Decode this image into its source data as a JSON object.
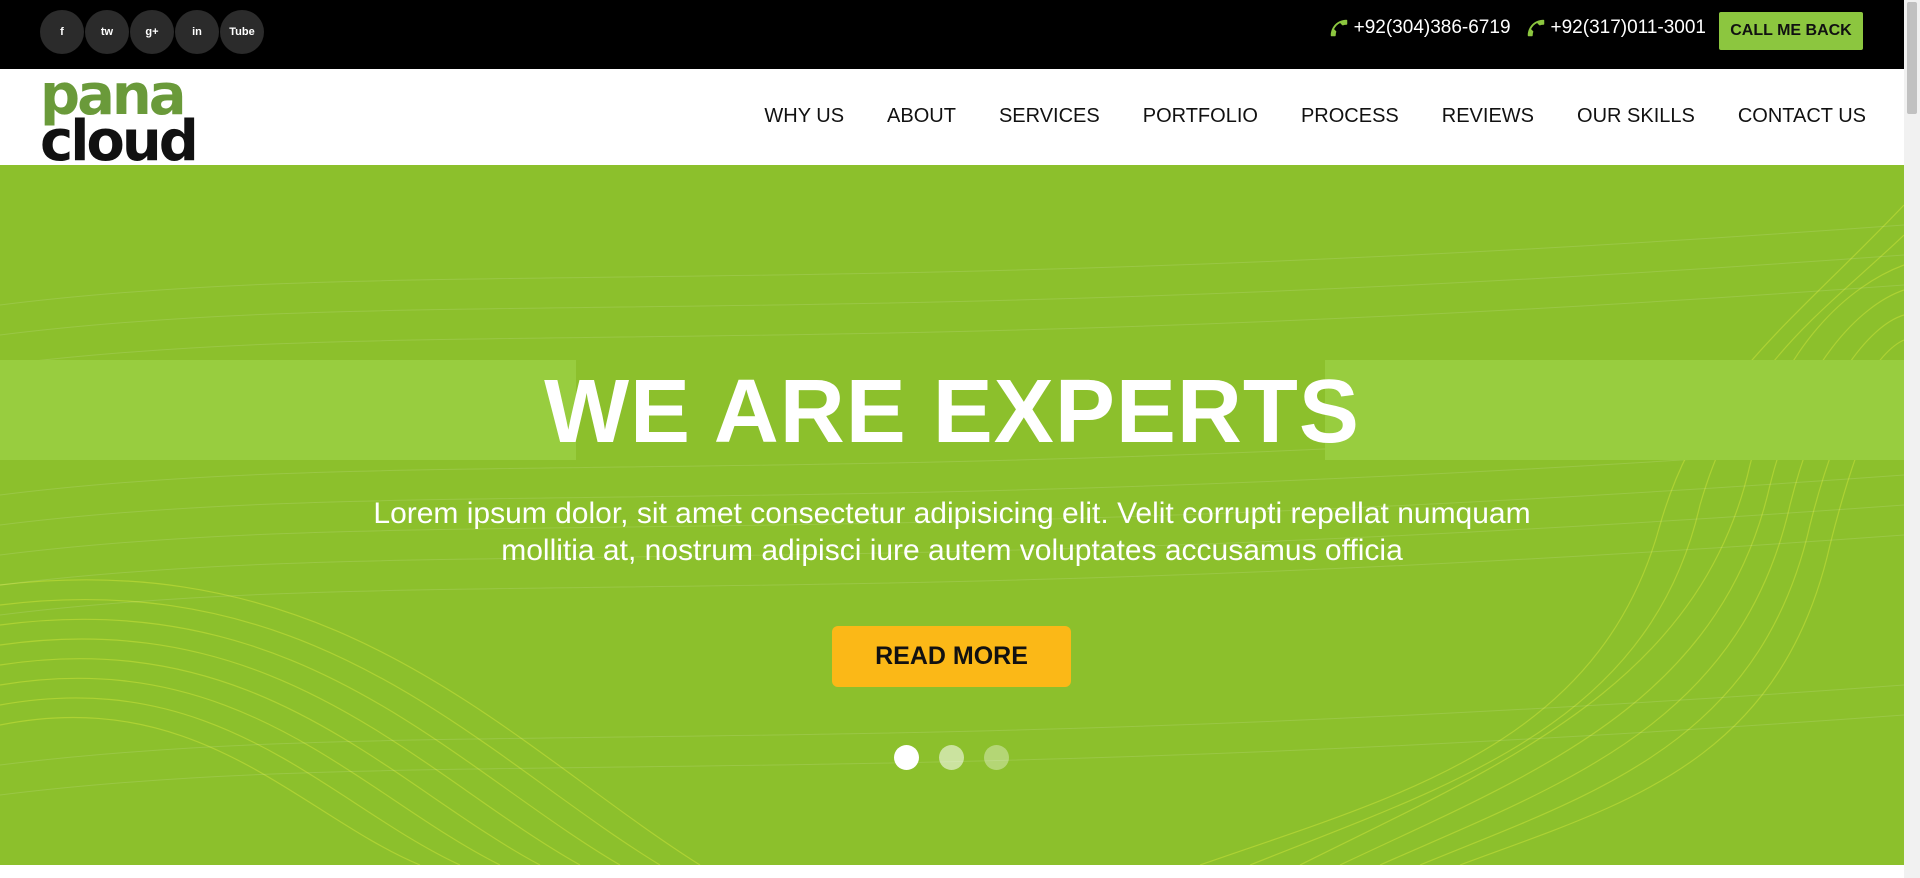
{
  "topbar": {
    "socials": [
      {
        "label": "f",
        "icon": "facebook-icon"
      },
      {
        "label": "tw",
        "icon": "twitter-icon"
      },
      {
        "label": "g+",
        "icon": "google-plus-icon"
      },
      {
        "label": "in",
        "icon": "linkedin-icon"
      },
      {
        "label": "Tube",
        "icon": "youtube-icon"
      }
    ],
    "phone1": "+92(304)386-6719",
    "phone2": "+92(317)011-3001",
    "callback_label": "CALL ME BACK"
  },
  "logo": {
    "line1": "pana",
    "line2": "cloud"
  },
  "nav": {
    "items": [
      "WHY US",
      "ABOUT",
      "SERVICES",
      "PORTFOLIO",
      "PROCESS",
      "REVIEWS",
      "OUR SKILLS",
      "CONTACT US"
    ]
  },
  "hero": {
    "title": "WE ARE EXPERTS",
    "text": "Lorem ipsum dolor, sit amet consectetur adipisicing elit. Velit corrupti repellat numquam mollitia at, nostrum adipisci iure autem voluptates accusamus officia",
    "button_label": "READ MORE",
    "slides": 3,
    "active_slide": 1
  },
  "colors": {
    "accent_green": "#8cc63f",
    "hero_green": "#8cc02c",
    "button_yellow": "#fbb817",
    "topbar_black": "#000000"
  }
}
